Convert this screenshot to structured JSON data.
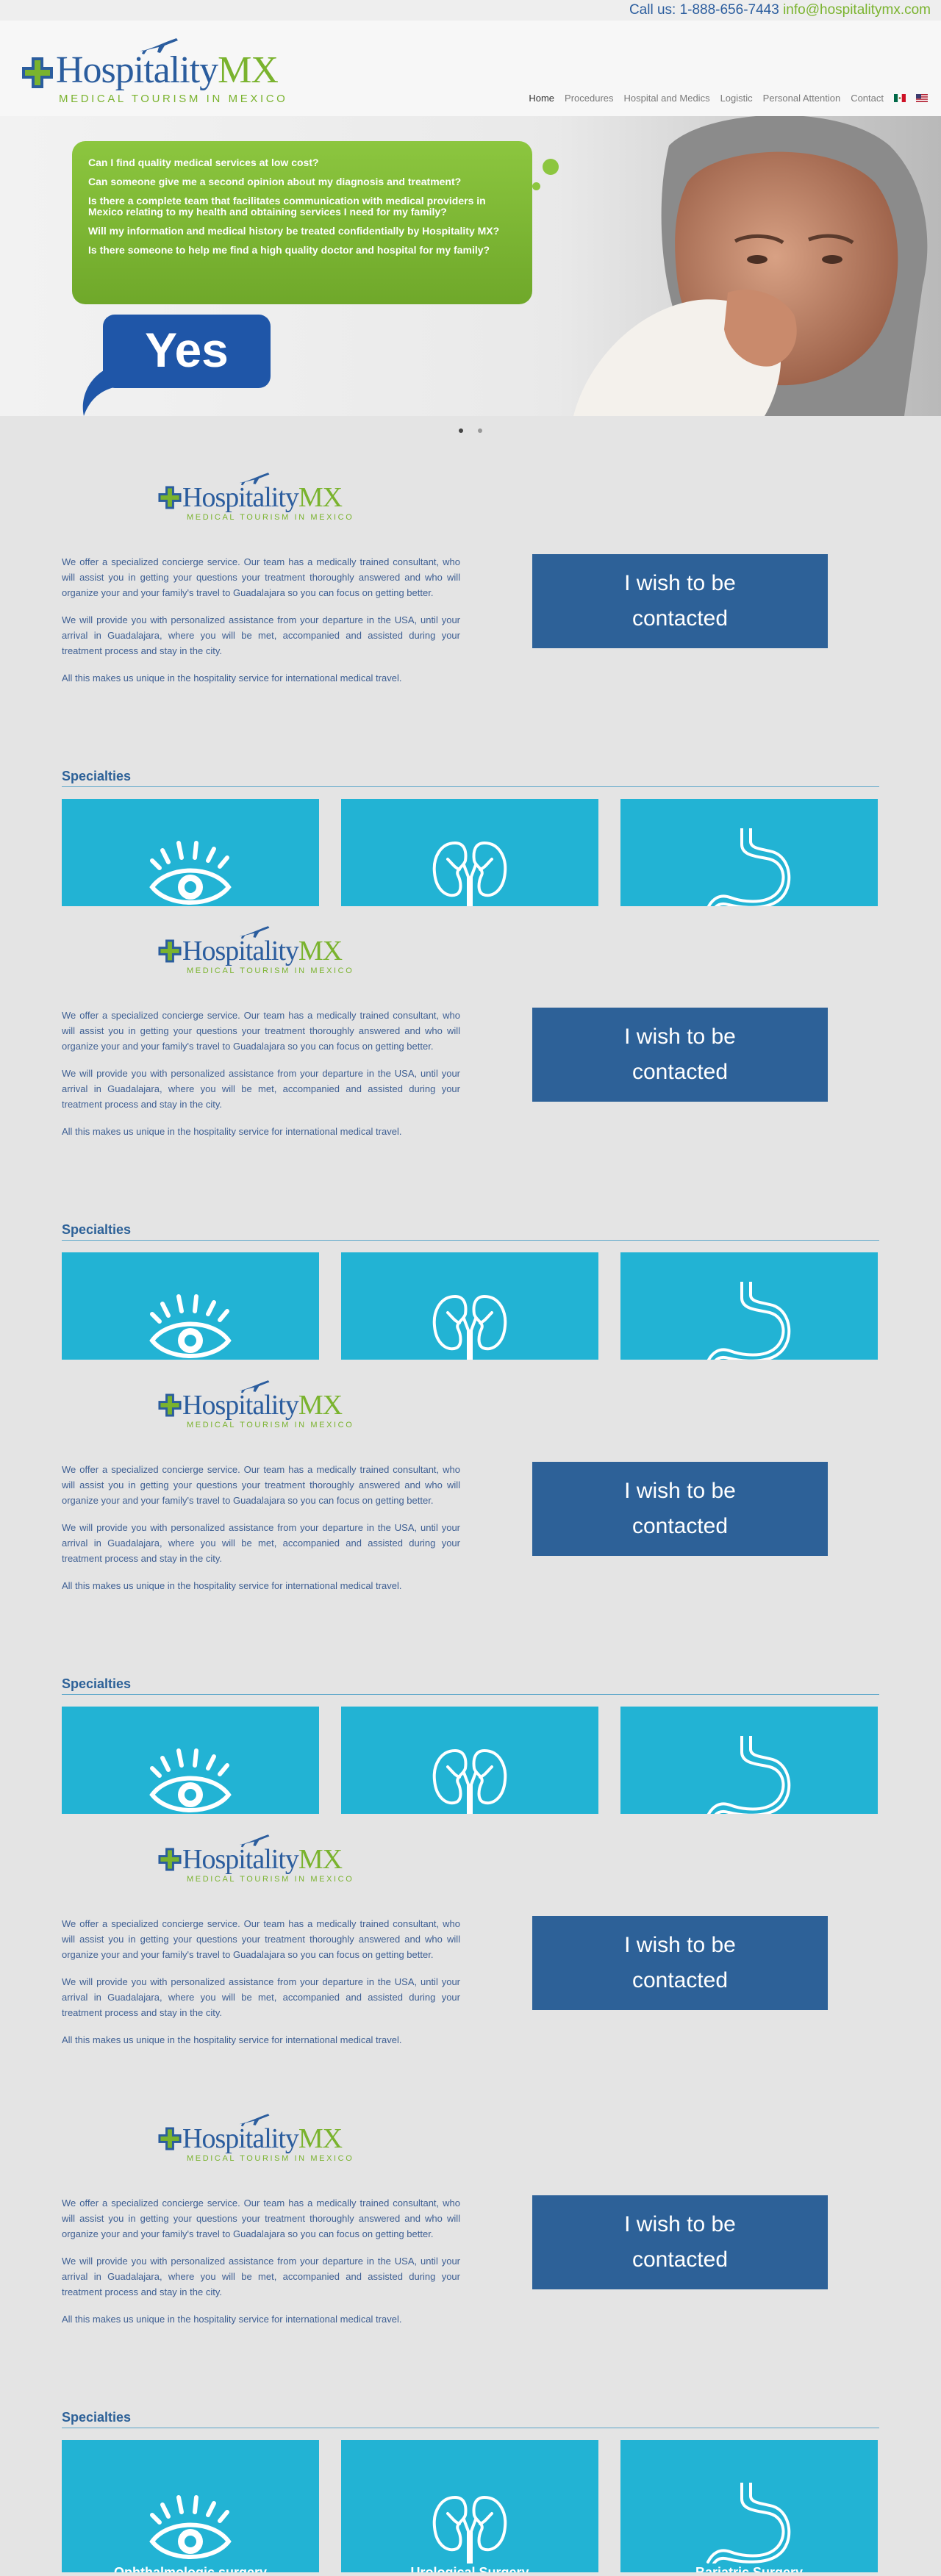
{
  "topbar": {
    "phone": "Call us: 1-888-656-7443",
    "email": "info@hospitalitymx.com"
  },
  "brand": {
    "name": "Hospitality",
    "suffix": "MX",
    "tagline": "MEDICAL TOURISM IN MEXICO"
  },
  "nav": {
    "items": [
      "Home",
      "Procedures",
      "Hospital and Medics",
      "Logistic",
      "Personal Attention",
      "Contact"
    ],
    "languages": [
      "mexico-flag-icon",
      "usa-flag-icon"
    ]
  },
  "hero": {
    "questions": [
      "Can I find quality medical services at low cost?",
      "Can someone give me a second opinion about my diagnosis and treatment?",
      "Is there a complete team that facilitates communication with medical providers in Mexico relating to my health and obtaining services I need for my family?",
      "Will my information and medical history be treated confidentially by Hospitality MX?",
      "Is there someone to help me find a high quality doctor and hospital for my family?"
    ],
    "answer": "Yes"
  },
  "intro": {
    "p1": "We offer a specialized concierge service. Our team has a medically trained consultant, who will assist you in getting your questions your treatment thoroughly answered and who will organize your and your family's travel to Guadalajara so you can focus on getting better.",
    "p2": "We will provide you with personalized assistance from your departure in the USA, until your arrival in Guadalajara, where you will be met, accompanied and assisted during your treatment process and stay in the city.",
    "p3": "All this makes us unique in the hospitality service for international medical travel."
  },
  "cta": {
    "line1": "I wish to be",
    "line2": "contacted"
  },
  "specialties": {
    "title": "Specialties",
    "tiles": [
      {
        "icon": "eye-icon",
        "label": "Ophthalmologic surgery"
      },
      {
        "icon": "kidney-icon",
        "label": "Urological Surgery"
      },
      {
        "icon": "stomach-icon",
        "label": "Bariatric Surgery"
      }
    ]
  },
  "colors": {
    "brand_blue": "#2b5d9e",
    "brand_green": "#7ab32e",
    "tile": "#22b3d4",
    "cta": "#2d6198"
  }
}
